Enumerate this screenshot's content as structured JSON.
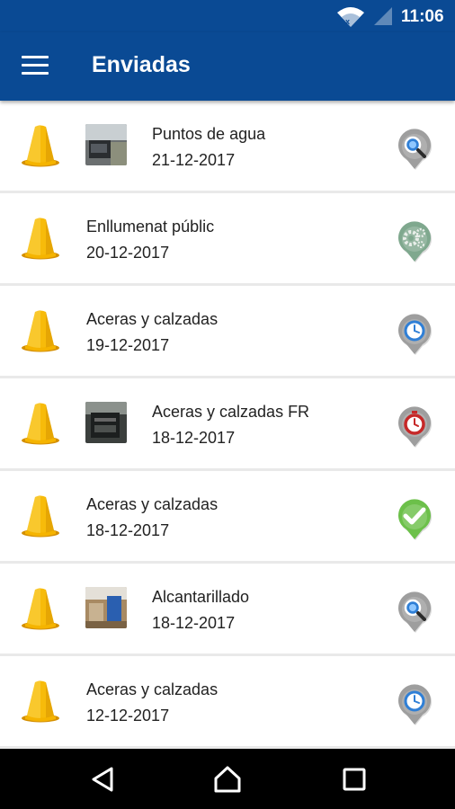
{
  "status_bar": {
    "time": "11:06",
    "wifi_icon": "wifi-icon",
    "signal_icon": "cell-signal-icon"
  },
  "app_bar": {
    "title": "Enviadas",
    "menu_icon": "hamburger-menu-icon"
  },
  "colors": {
    "app_bar": "#0a4a94",
    "cone": "#f5b400",
    "status_gray": "#9e9e9e",
    "status_green": "#6cc04a",
    "status_red": "#d32f2f",
    "nav_bar": "#000000"
  },
  "reports": [
    {
      "title": "Puntos de agua",
      "date": "21-12-2017",
      "has_thumbnail": true,
      "status_icon": "magnifier-status-icon"
    },
    {
      "title": "Enllumenat públic",
      "date": "20-12-2017",
      "has_thumbnail": false,
      "status_icon": "gear-status-icon"
    },
    {
      "title": "Aceras y calzadas",
      "date": "19-12-2017",
      "has_thumbnail": false,
      "status_icon": "clock-status-icon"
    },
    {
      "title": "Aceras y calzadas FR",
      "date": "18-12-2017",
      "has_thumbnail": true,
      "status_icon": "stopwatch-status-icon"
    },
    {
      "title": "Aceras y calzadas",
      "date": "18-12-2017",
      "has_thumbnail": false,
      "status_icon": "checkmark-status-icon"
    },
    {
      "title": "Alcantarillado",
      "date": "18-12-2017",
      "has_thumbnail": true,
      "status_icon": "magnifier-status-icon"
    },
    {
      "title": "Aceras y calzadas",
      "date": "12-12-2017",
      "has_thumbnail": false,
      "status_icon": "clock-status-icon"
    }
  ],
  "nav_bar": {
    "back_icon": "back-triangle-icon",
    "home_icon": "home-icon",
    "recents_icon": "recents-square-icon"
  }
}
